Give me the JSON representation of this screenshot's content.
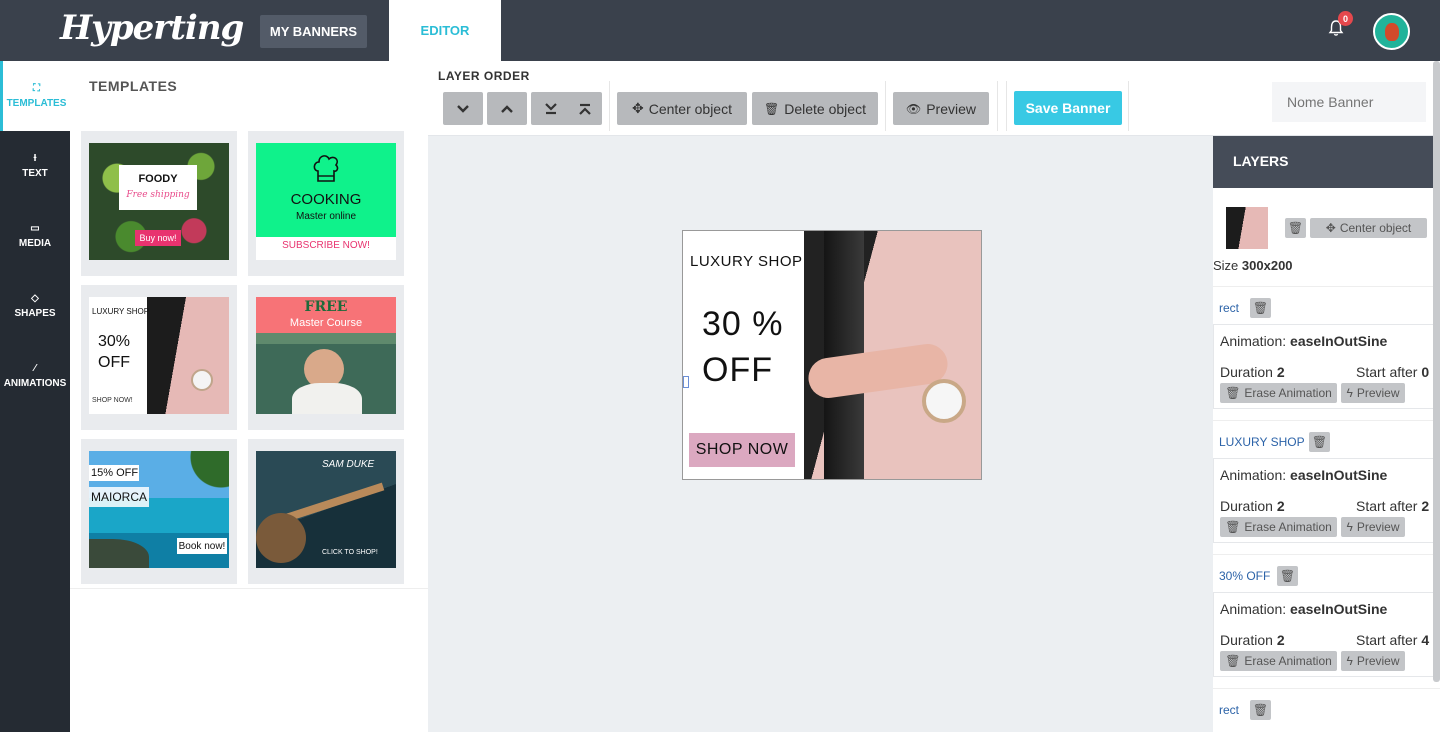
{
  "header": {
    "logo": "Hyperting",
    "my_banners": "MY BANNERS",
    "editor_tab": "EDITOR",
    "notification_count": "0"
  },
  "sidebar": {
    "items": [
      {
        "label": "TEMPLATES",
        "icon": "expand-icon"
      },
      {
        "label": "TEXT",
        "icon": "text-cursor-icon"
      },
      {
        "label": "MEDIA",
        "icon": "image-icon"
      },
      {
        "label": "SHAPES",
        "icon": "diamond-icon"
      },
      {
        "label": "ANIMATIONS",
        "icon": "magic-wand-icon"
      }
    ]
  },
  "templates": {
    "title": "TEMPLATES",
    "items": [
      {
        "name": "foody",
        "title": "FOODY",
        "script": "Free shipping",
        "cta": "Buy now!"
      },
      {
        "name": "cooking",
        "title": "COOKING",
        "subtitle": "Master online",
        "cta": "SUBSCRIBE NOW!"
      },
      {
        "name": "luxury",
        "title": "LUXURY SHOP",
        "offer": "30% OFF",
        "cta": "SHOP NOW!"
      },
      {
        "name": "free-course",
        "title": "FREE",
        "subtitle": "Master Course"
      },
      {
        "name": "maiorca",
        "offer": "15% OFF",
        "title": "MAIORCA",
        "cta": "Book now!"
      },
      {
        "name": "guitar",
        "title": "SAM DUKE",
        "cta": "CLICK TO SHOP!"
      }
    ]
  },
  "toolbar": {
    "layer_order": "LAYER ORDER",
    "center_object": "Center object",
    "delete_object": "Delete object",
    "preview": "Preview",
    "save_banner": "Save Banner",
    "banner_name_placeholder": "Nome Banner"
  },
  "banner": {
    "shop": "LUXURY SHOP",
    "offer_line1": "30 %",
    "offer_line2": "OFF",
    "cta": "SHOP NOW",
    "cta_color": "#dba8c0"
  },
  "layers": {
    "title": "LAYERS",
    "center_object": "Center object",
    "size_label": "Size",
    "size_value": "300x200",
    "animation_label": "Animation:",
    "duration_label": "Duration",
    "start_after_label": "Start after",
    "erase_animation": "Erase Animation",
    "preview": "Preview",
    "list": [
      {
        "name": "rect",
        "easing": "easeInOutSine",
        "duration": "2",
        "start_after": "0"
      },
      {
        "name": "LUXURY SHOP",
        "easing": "easeInOutSine",
        "duration": "2",
        "start_after": "2"
      },
      {
        "name": "30% OFF",
        "easing": "easeInOutSine",
        "duration": "2",
        "start_after": "4"
      },
      {
        "name": "rect"
      }
    ]
  },
  "colors": {
    "accent": "#2bbdd6",
    "save_button": "#38c9e4",
    "topbar": "#3a414c",
    "sidebar": "#252b33"
  }
}
